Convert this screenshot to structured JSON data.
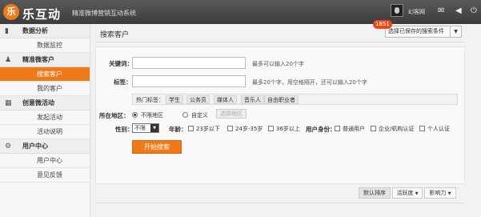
{
  "header": {
    "logo_mark": "乐",
    "logo_text": "乐互动",
    "slogan": "精准微博营销互动系统",
    "username": "幻客网",
    "icons": [
      "avatar",
      "mail-icon",
      "volume-icon",
      "power-icon"
    ]
  },
  "sidebar": {
    "sections": [
      {
        "icon": "bar-chart-icon",
        "title": "数据分析",
        "items": [
          "数据监控"
        ]
      },
      {
        "icon": "user-icon",
        "title": "精准微客户",
        "items": [
          "搜索客户",
          "我的客户"
        ]
      },
      {
        "icon": "grid-icon",
        "title": "创意微活动",
        "items": [
          "发起活动",
          "活动说明"
        ]
      },
      {
        "icon": "gear-icon",
        "title": "用户中心",
        "items": [
          "用户中心",
          "意见反馈"
        ]
      }
    ],
    "active_item": "搜索客户"
  },
  "main": {
    "title": "搜索客户",
    "saved_conditions": {
      "badge": "1851",
      "label": "选择已保存的搜索条件",
      "arrow": "▼"
    },
    "form": {
      "keyword": {
        "label": "关键词：",
        "value": "",
        "hint": "最多可以输入20个字"
      },
      "tags": {
        "label": "标签：",
        "value": "",
        "hint": "最多20个字，用空格隔开，还可以输入20个字"
      },
      "hot_tags": {
        "label": "热门标签：",
        "items": [
          "学生",
          "公务员",
          "媒体人",
          "音乐人",
          "自由职业者"
        ]
      },
      "region": {
        "label": "所在地区：",
        "options": [
          "不限地区",
          "自定义"
        ],
        "selected": "不限地区",
        "select_button": "选择地区"
      },
      "gender": {
        "label": "性别：",
        "value": "不限",
        "arrow": "▼"
      },
      "age": {
        "label": "年龄：",
        "options": [
          "23岁以下",
          "24岁-35岁",
          "36岁以上"
        ]
      },
      "identity": {
        "label": "用户身份：",
        "options": [
          "普通用户",
          "企业/机构认证",
          "个人认证"
        ]
      },
      "submit": "开始搜索"
    },
    "sort": {
      "options": [
        {
          "label": "默认排序",
          "arrow": ""
        },
        {
          "label": "活跃度",
          "arrow": "▼"
        },
        {
          "label": "影响力",
          "arrow": "▼"
        }
      ]
    }
  }
}
